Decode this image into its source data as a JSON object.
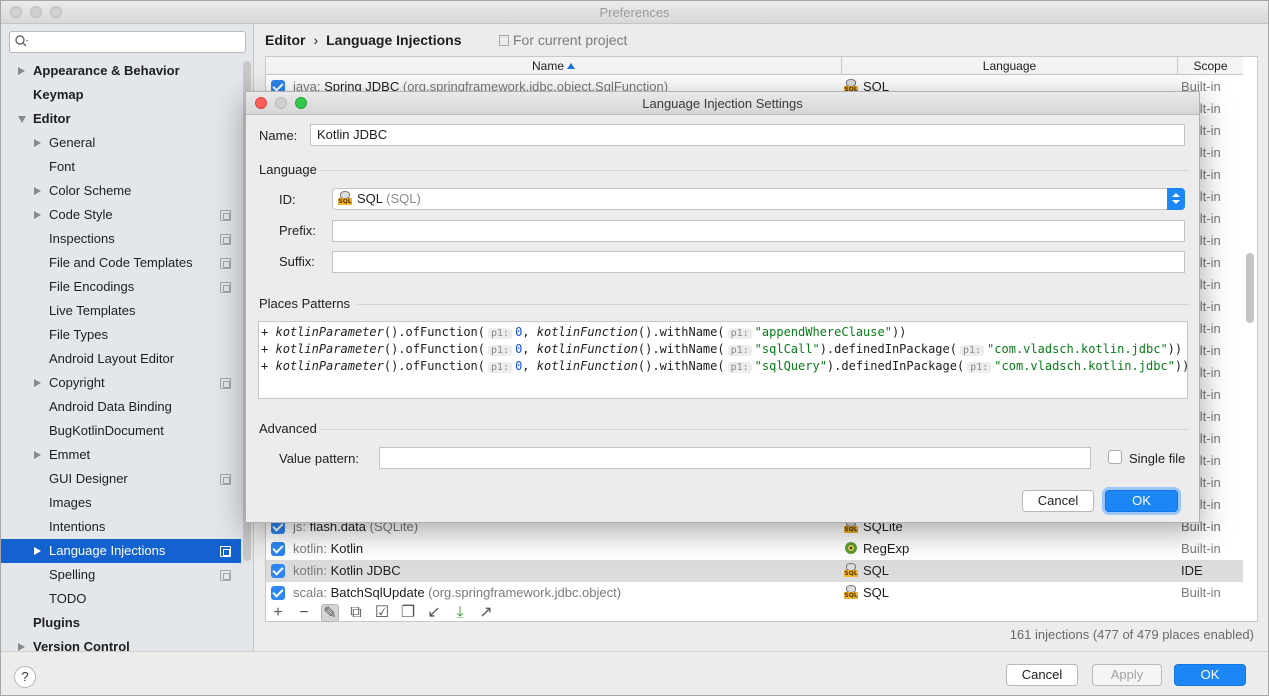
{
  "window": {
    "title": "Preferences"
  },
  "search": {
    "placeholder": ""
  },
  "sidebar": {
    "items": [
      {
        "label": "Appearance & Behavior",
        "level": 0,
        "bold": true,
        "expand": "right",
        "copy": false
      },
      {
        "label": "Keymap",
        "level": 0,
        "bold": true,
        "expand": "none",
        "copy": false
      },
      {
        "label": "Editor",
        "level": 0,
        "bold": true,
        "expand": "down",
        "copy": false
      },
      {
        "label": "General",
        "level": 1,
        "bold": false,
        "expand": "right",
        "copy": false
      },
      {
        "label": "Font",
        "level": 1,
        "bold": false,
        "expand": "none",
        "copy": false
      },
      {
        "label": "Color Scheme",
        "level": 1,
        "bold": false,
        "expand": "right",
        "copy": false
      },
      {
        "label": "Code Style",
        "level": 1,
        "bold": false,
        "expand": "right",
        "copy": true
      },
      {
        "label": "Inspections",
        "level": 1,
        "bold": false,
        "expand": "none",
        "copy": true
      },
      {
        "label": "File and Code Templates",
        "level": 1,
        "bold": false,
        "expand": "none",
        "copy": true
      },
      {
        "label": "File Encodings",
        "level": 1,
        "bold": false,
        "expand": "none",
        "copy": true
      },
      {
        "label": "Live Templates",
        "level": 1,
        "bold": false,
        "expand": "none",
        "copy": false
      },
      {
        "label": "File Types",
        "level": 1,
        "bold": false,
        "expand": "none",
        "copy": false
      },
      {
        "label": "Android Layout Editor",
        "level": 1,
        "bold": false,
        "expand": "none",
        "copy": false
      },
      {
        "label": "Copyright",
        "level": 1,
        "bold": false,
        "expand": "right",
        "copy": true
      },
      {
        "label": "Android Data Binding",
        "level": 1,
        "bold": false,
        "expand": "none",
        "copy": false
      },
      {
        "label": "BugKotlinDocument",
        "level": 1,
        "bold": false,
        "expand": "none",
        "copy": false
      },
      {
        "label": "Emmet",
        "level": 1,
        "bold": false,
        "expand": "right",
        "copy": false
      },
      {
        "label": "GUI Designer",
        "level": 1,
        "bold": false,
        "expand": "none",
        "copy": true
      },
      {
        "label": "Images",
        "level": 1,
        "bold": false,
        "expand": "none",
        "copy": false
      },
      {
        "label": "Intentions",
        "level": 1,
        "bold": false,
        "expand": "none",
        "copy": false
      },
      {
        "label": "Language Injections",
        "level": 1,
        "bold": false,
        "expand": "right",
        "copy": true,
        "selected": true
      },
      {
        "label": "Spelling",
        "level": 1,
        "bold": false,
        "expand": "none",
        "copy": true
      },
      {
        "label": "TODO",
        "level": 1,
        "bold": false,
        "expand": "none",
        "copy": false
      },
      {
        "label": "Plugins",
        "level": 0,
        "bold": true,
        "expand": "none",
        "copy": false
      },
      {
        "label": "Version Control",
        "level": 0,
        "bold": true,
        "expand": "right",
        "copy": false
      }
    ]
  },
  "breadcrumb": {
    "parent": "Editor",
    "separator": "›",
    "current": "Language Injections"
  },
  "for_project": "For current project",
  "table": {
    "headers": {
      "name": "Name",
      "language": "Language",
      "scope": "Scope"
    },
    "rows_top": [
      {
        "prefix": "java:",
        "name": "Spring JDBC",
        "arg": "(org.springframework.jdbc.object.SqlFunction)",
        "language": "SQL",
        "icon": "sql",
        "scope": "Built-in"
      }
    ],
    "hidden_scopes": [
      "Built-in",
      "Built-in",
      "Built-in",
      "Built-in",
      "Built-in",
      "Built-in",
      "Built-in",
      "Built-in",
      "Built-in",
      "Built-in",
      "Built-in",
      "Built-in",
      "Built-in",
      "Built-in",
      "Built-in",
      "Built-in",
      "Built-in",
      "Built-in",
      "Built-in",
      "Built-in"
    ],
    "rows_bottom": [
      {
        "prefix": "js:",
        "name": "flash.data",
        "arg": "(SQLite)",
        "language": "SQLite",
        "icon": "sql",
        "scope": "Built-in",
        "selected": false
      },
      {
        "prefix": "kotlin:",
        "name": "Kotlin",
        "arg": "",
        "language": "RegExp",
        "icon": "regex",
        "scope": "Built-in",
        "selected": false
      },
      {
        "prefix": "kotlin:",
        "name": "Kotlin JDBC",
        "arg": "",
        "language": "SQL",
        "icon": "sql",
        "scope": "IDE",
        "selected": true
      },
      {
        "prefix": "scala:",
        "name": "BatchSqlUpdate",
        "arg": "(org.springframework.jdbc.object)",
        "language": "SQL",
        "icon": "sql",
        "scope": "Built-in",
        "selected": false
      }
    ],
    "toolbar": [
      "add-icon",
      "remove-icon",
      "edit-icon",
      "copy-icon",
      "check-icon",
      "duplicate-icon",
      "import-icon",
      "download-icon",
      "export-icon"
    ],
    "sql_tag": "SQL"
  },
  "count_info": "161 injections (477 of 479 places enabled)",
  "bottom": {
    "help": "?",
    "cancel": "Cancel",
    "apply": "Apply",
    "ok": "OK"
  },
  "dialog": {
    "title": "Language Injection Settings",
    "name_label": "Name:",
    "name_value": "Kotlin JDBC",
    "language_section": "Language",
    "id_label": "ID:",
    "id_value": "SQL",
    "id_hint": "(SQL)",
    "prefix_label": "Prefix:",
    "prefix_value": "",
    "suffix_label": "Suffix:",
    "suffix_value": "",
    "places_section": "Places Patterns",
    "patterns": [
      {
        "plus": "+",
        "f1": "kotlinParameter",
        "m1": "().ofFunction(",
        "h1": "p1:",
        "n1": "0",
        "sep": ", ",
        "f2": "kotlinFunction",
        "m2": "().withName(",
        "h2": "p1:",
        "s1": "\"appendWhereClause\"",
        "m3": "",
        "h3": "",
        "s2": "",
        "end": "))"
      },
      {
        "plus": "+",
        "f1": "kotlinParameter",
        "m1": "().ofFunction(",
        "h1": "p1:",
        "n1": "0",
        "sep": ", ",
        "f2": "kotlinFunction",
        "m2": "().withName(",
        "h2": "p1:",
        "s1": "\"sqlCall\"",
        "m3": ").definedInPackage(",
        "h3": "p1:",
        "s2": "\"com.vladsch.kotlin.jdbc\"",
        "end": "))"
      },
      {
        "plus": "+",
        "f1": "kotlinParameter",
        "m1": "().ofFunction(",
        "h1": "p1:",
        "n1": "0",
        "sep": ", ",
        "f2": "kotlinFunction",
        "m2": "().withName(",
        "h2": "p1:",
        "s1": "\"sqlQuery\"",
        "m3": ").definedInPackage(",
        "h3": "p1:",
        "s2": "\"com.vladsch.kotlin.jdbc\"",
        "end": "))"
      }
    ],
    "advanced_section": "Advanced",
    "value_pattern_label": "Value pattern:",
    "value_pattern_value": "",
    "single_file_label": "Single file",
    "cancel": "Cancel",
    "ok": "OK"
  },
  "colors": {
    "accent": "#1b86f4",
    "selection": "#1461d0",
    "string": "#067d17",
    "number": "#1750eb"
  }
}
